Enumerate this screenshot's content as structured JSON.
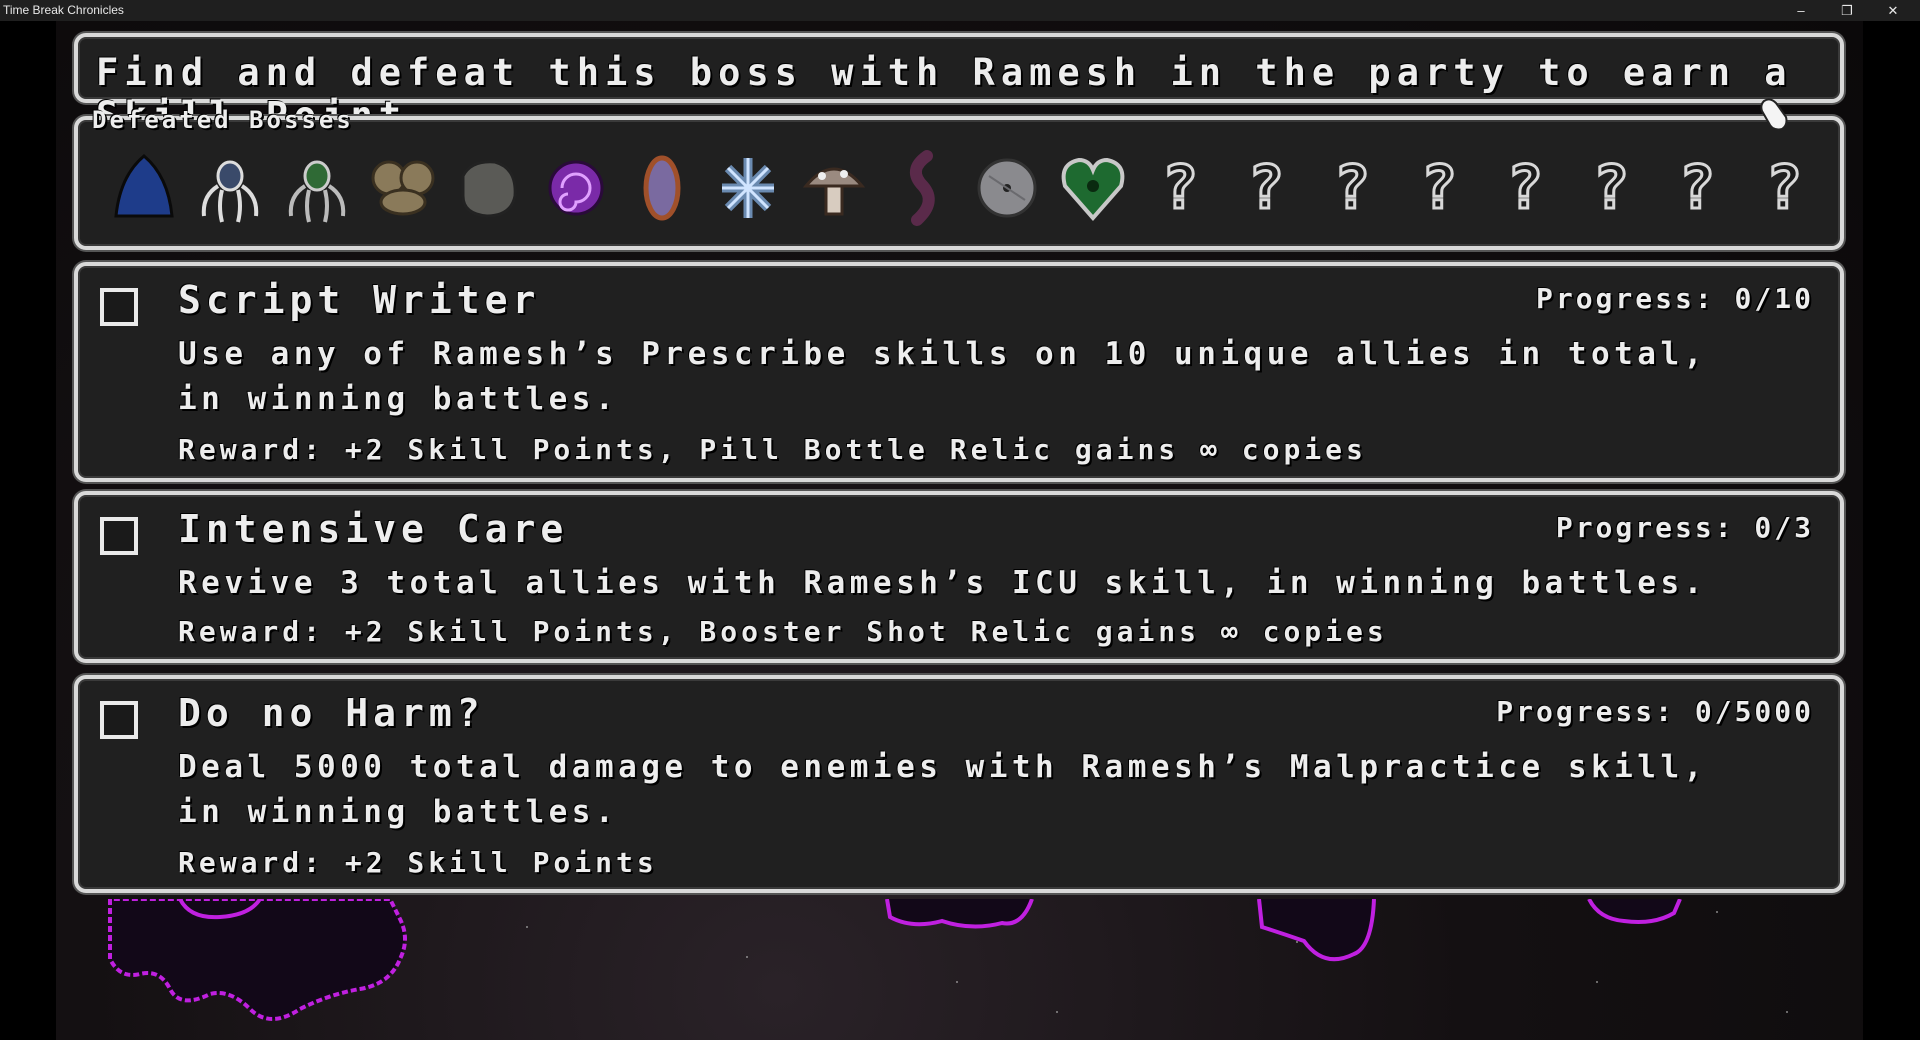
{
  "window": {
    "title": "Time Break Chronicles",
    "minimize_glyph": "–",
    "restore_glyph": "❐",
    "close_glyph": "✕"
  },
  "hint": {
    "text": "Find and defeat this boss with Ramesh in the party to earn a Skill Point."
  },
  "bosses": {
    "label": "Defeated Bosses",
    "slots": [
      {
        "icon": "blue-slime-boss-icon",
        "defeated": true,
        "color": "#1e3c8a"
      },
      {
        "icon": "dark-spider-boss-icon",
        "defeated": true,
        "color": "#3a4a6a"
      },
      {
        "icon": "green-spider-boss-icon",
        "defeated": true,
        "color": "#2f6a35"
      },
      {
        "icon": "twin-shell-boss-icon",
        "defeated": true,
        "color": "#8a7a5a"
      },
      {
        "icon": "stone-boss-icon",
        "defeated": true,
        "color": "#5a5a56"
      },
      {
        "icon": "purple-vortex-boss-icon",
        "defeated": true,
        "color": "#7a2aa8"
      },
      {
        "icon": "mirror-boss-icon",
        "defeated": true,
        "color": "#7a6aa0"
      },
      {
        "icon": "ice-crystal-boss-icon",
        "defeated": true,
        "color": "#6a8ab0"
      },
      {
        "icon": "mushroom-boss-icon",
        "defeated": true,
        "color": "#9a8a80"
      },
      {
        "icon": "tentacle-boss-icon",
        "defeated": true,
        "color": "#5a2a4a"
      },
      {
        "icon": "disc-boss-icon",
        "defeated": true,
        "color": "#8a8a8e"
      },
      {
        "icon": "heart-boss-icon",
        "defeated": true,
        "color": "#1e6a30"
      },
      {
        "icon": "question-mark-icon",
        "defeated": false,
        "glyph": "?"
      },
      {
        "icon": "question-mark-icon",
        "defeated": false,
        "glyph": "?"
      },
      {
        "icon": "question-mark-icon",
        "defeated": false,
        "glyph": "?"
      },
      {
        "icon": "question-mark-icon",
        "defeated": false,
        "glyph": "?"
      },
      {
        "icon": "question-mark-icon",
        "defeated": false,
        "glyph": "?"
      },
      {
        "icon": "question-mark-icon",
        "defeated": false,
        "glyph": "?"
      },
      {
        "icon": "question-mark-icon",
        "defeated": false,
        "glyph": "?"
      },
      {
        "icon": "question-mark-icon",
        "defeated": false,
        "glyph": "?"
      }
    ]
  },
  "quests": [
    {
      "title": "Script Writer",
      "progress": "Progress: 0/10",
      "description": "Use any of Ramesh’s Prescribe skills on 10 unique allies in total, in winning battles.",
      "reward": "Reward: +2 Skill Points, Pill Bottle Relic gains ∞ copies",
      "checked": false
    },
    {
      "title": "Intensive Care",
      "progress": "Progress: 0/3",
      "description": "Revive 3 total allies with Ramesh’s ICU skill, in winning battles.",
      "reward": "Reward: +2 Skill Points, Booster Shot Relic gains ∞ copies",
      "checked": false
    },
    {
      "title": "Do no Harm?",
      "progress": "Progress: 0/5000",
      "description": "Deal 5000 total damage to enemies with Ramesh’s Malpractice skill, in winning battles.",
      "reward": "Reward: +2 Skill Points",
      "checked": false
    }
  ],
  "colors": {
    "panel_bg": "#202020",
    "panel_border": "#d9d9d9",
    "text": "#ededed",
    "void_purple": "#c020e0"
  }
}
